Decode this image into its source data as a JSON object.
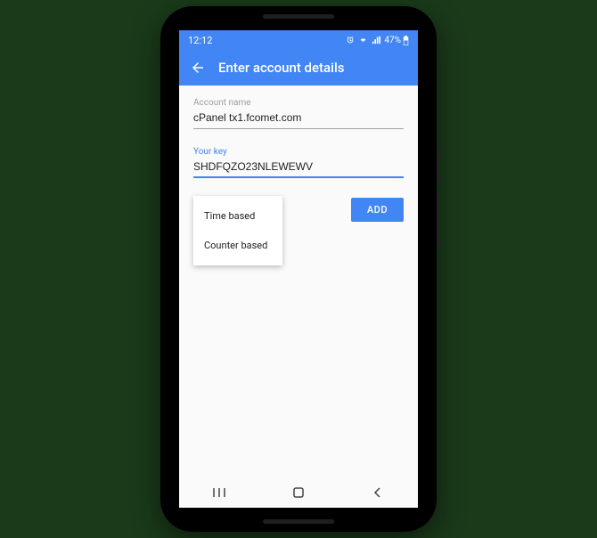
{
  "status": {
    "time": "12:12",
    "battery_pct": "47%"
  },
  "appbar": {
    "title": "Enter account details"
  },
  "fields": {
    "account_name": {
      "label": "Account name",
      "value": "cPanel tx1.fcomet.com"
    },
    "your_key": {
      "label": "Your key",
      "value": "SHDFQZO23NLEWEWV"
    }
  },
  "dropdown": {
    "options": [
      "Time based",
      "Counter based"
    ]
  },
  "buttons": {
    "add": "ADD"
  }
}
